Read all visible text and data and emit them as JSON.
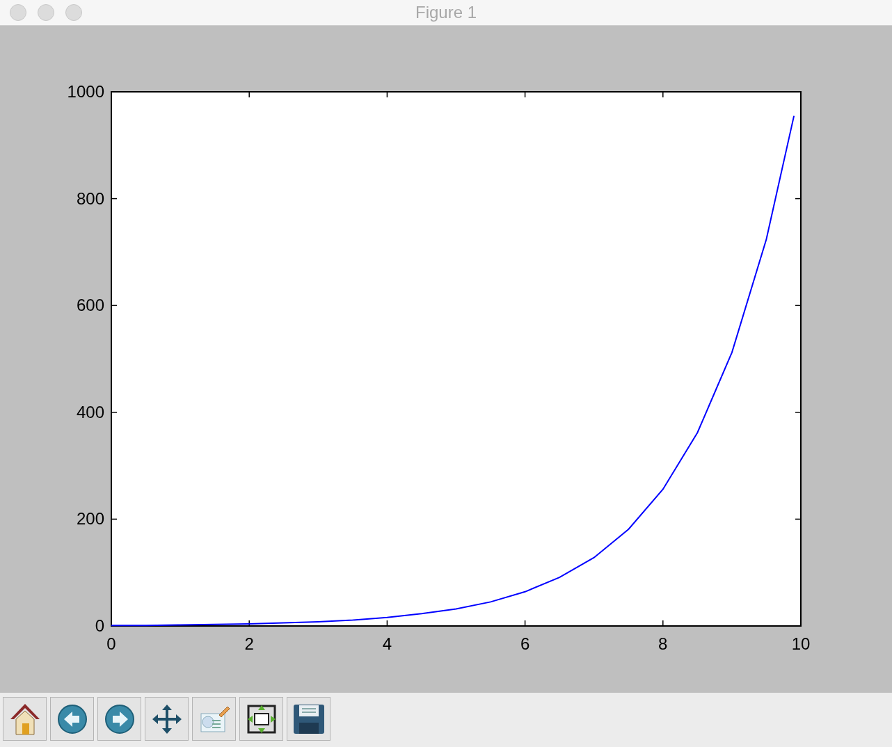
{
  "window": {
    "title": "Figure 1"
  },
  "figure": {
    "chart_data": {
      "type": "line",
      "x": [
        0,
        0.5,
        1,
        1.5,
        2,
        2.5,
        3,
        3.5,
        4,
        4.5,
        5,
        5.5,
        6,
        6.5,
        7,
        7.5,
        8,
        8.5,
        9,
        9.5,
        9.9
      ],
      "series": [
        {
          "color": "#0000ff",
          "values": [
            1,
            1,
            2,
            3,
            4,
            6,
            8,
            11,
            16,
            23,
            32,
            45,
            64,
            91,
            128,
            181,
            256,
            362,
            512,
            724,
            955
          ]
        }
      ],
      "xlim": [
        0,
        10
      ],
      "ylim": [
        0,
        1000
      ],
      "xticks": [
        0,
        2,
        4,
        6,
        8,
        10
      ],
      "yticks": [
        0,
        200,
        400,
        600,
        800,
        1000
      ]
    }
  }
}
